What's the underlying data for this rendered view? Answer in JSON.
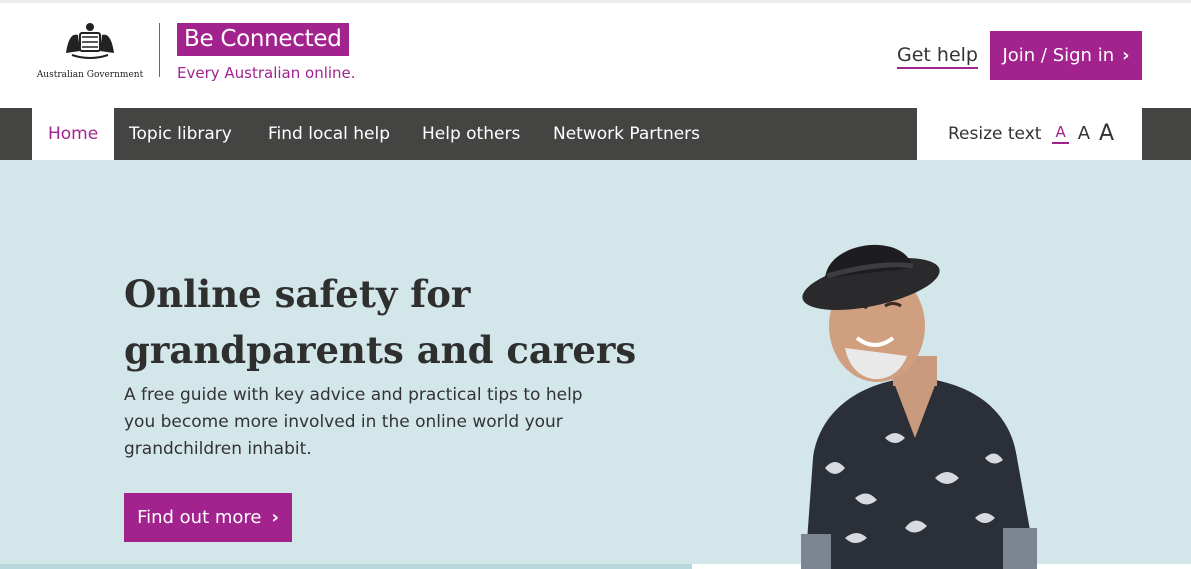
{
  "header": {
    "government_name": "Australian Government",
    "brand_title": "Be Connected",
    "brand_tagline": "Every Australian online.",
    "get_help": "Get help",
    "join_sign_in": "Join / Sign in",
    "chevron": "›"
  },
  "nav": {
    "items": [
      {
        "label": "Home",
        "active": true
      },
      {
        "label": "Topic library"
      },
      {
        "label": "Find local help"
      },
      {
        "label": "Help others"
      },
      {
        "label": "Network Partners"
      }
    ],
    "resize_label": "Resize text",
    "sizes": [
      "A",
      "A",
      "A"
    ]
  },
  "hero": {
    "title": "Online safety for grandparents and carers",
    "text": "A free guide with key advice and practical tips to help you become more involved in the online world your grandchildren inhabit.",
    "button": "Find out more",
    "chevron": "›",
    "photo": "smiling-older-man-in-hat-and-floral-shirt"
  },
  "colors": {
    "brand": "#a3238e",
    "nav_bg": "#444443",
    "hero_bg": "#d3e6ea"
  }
}
